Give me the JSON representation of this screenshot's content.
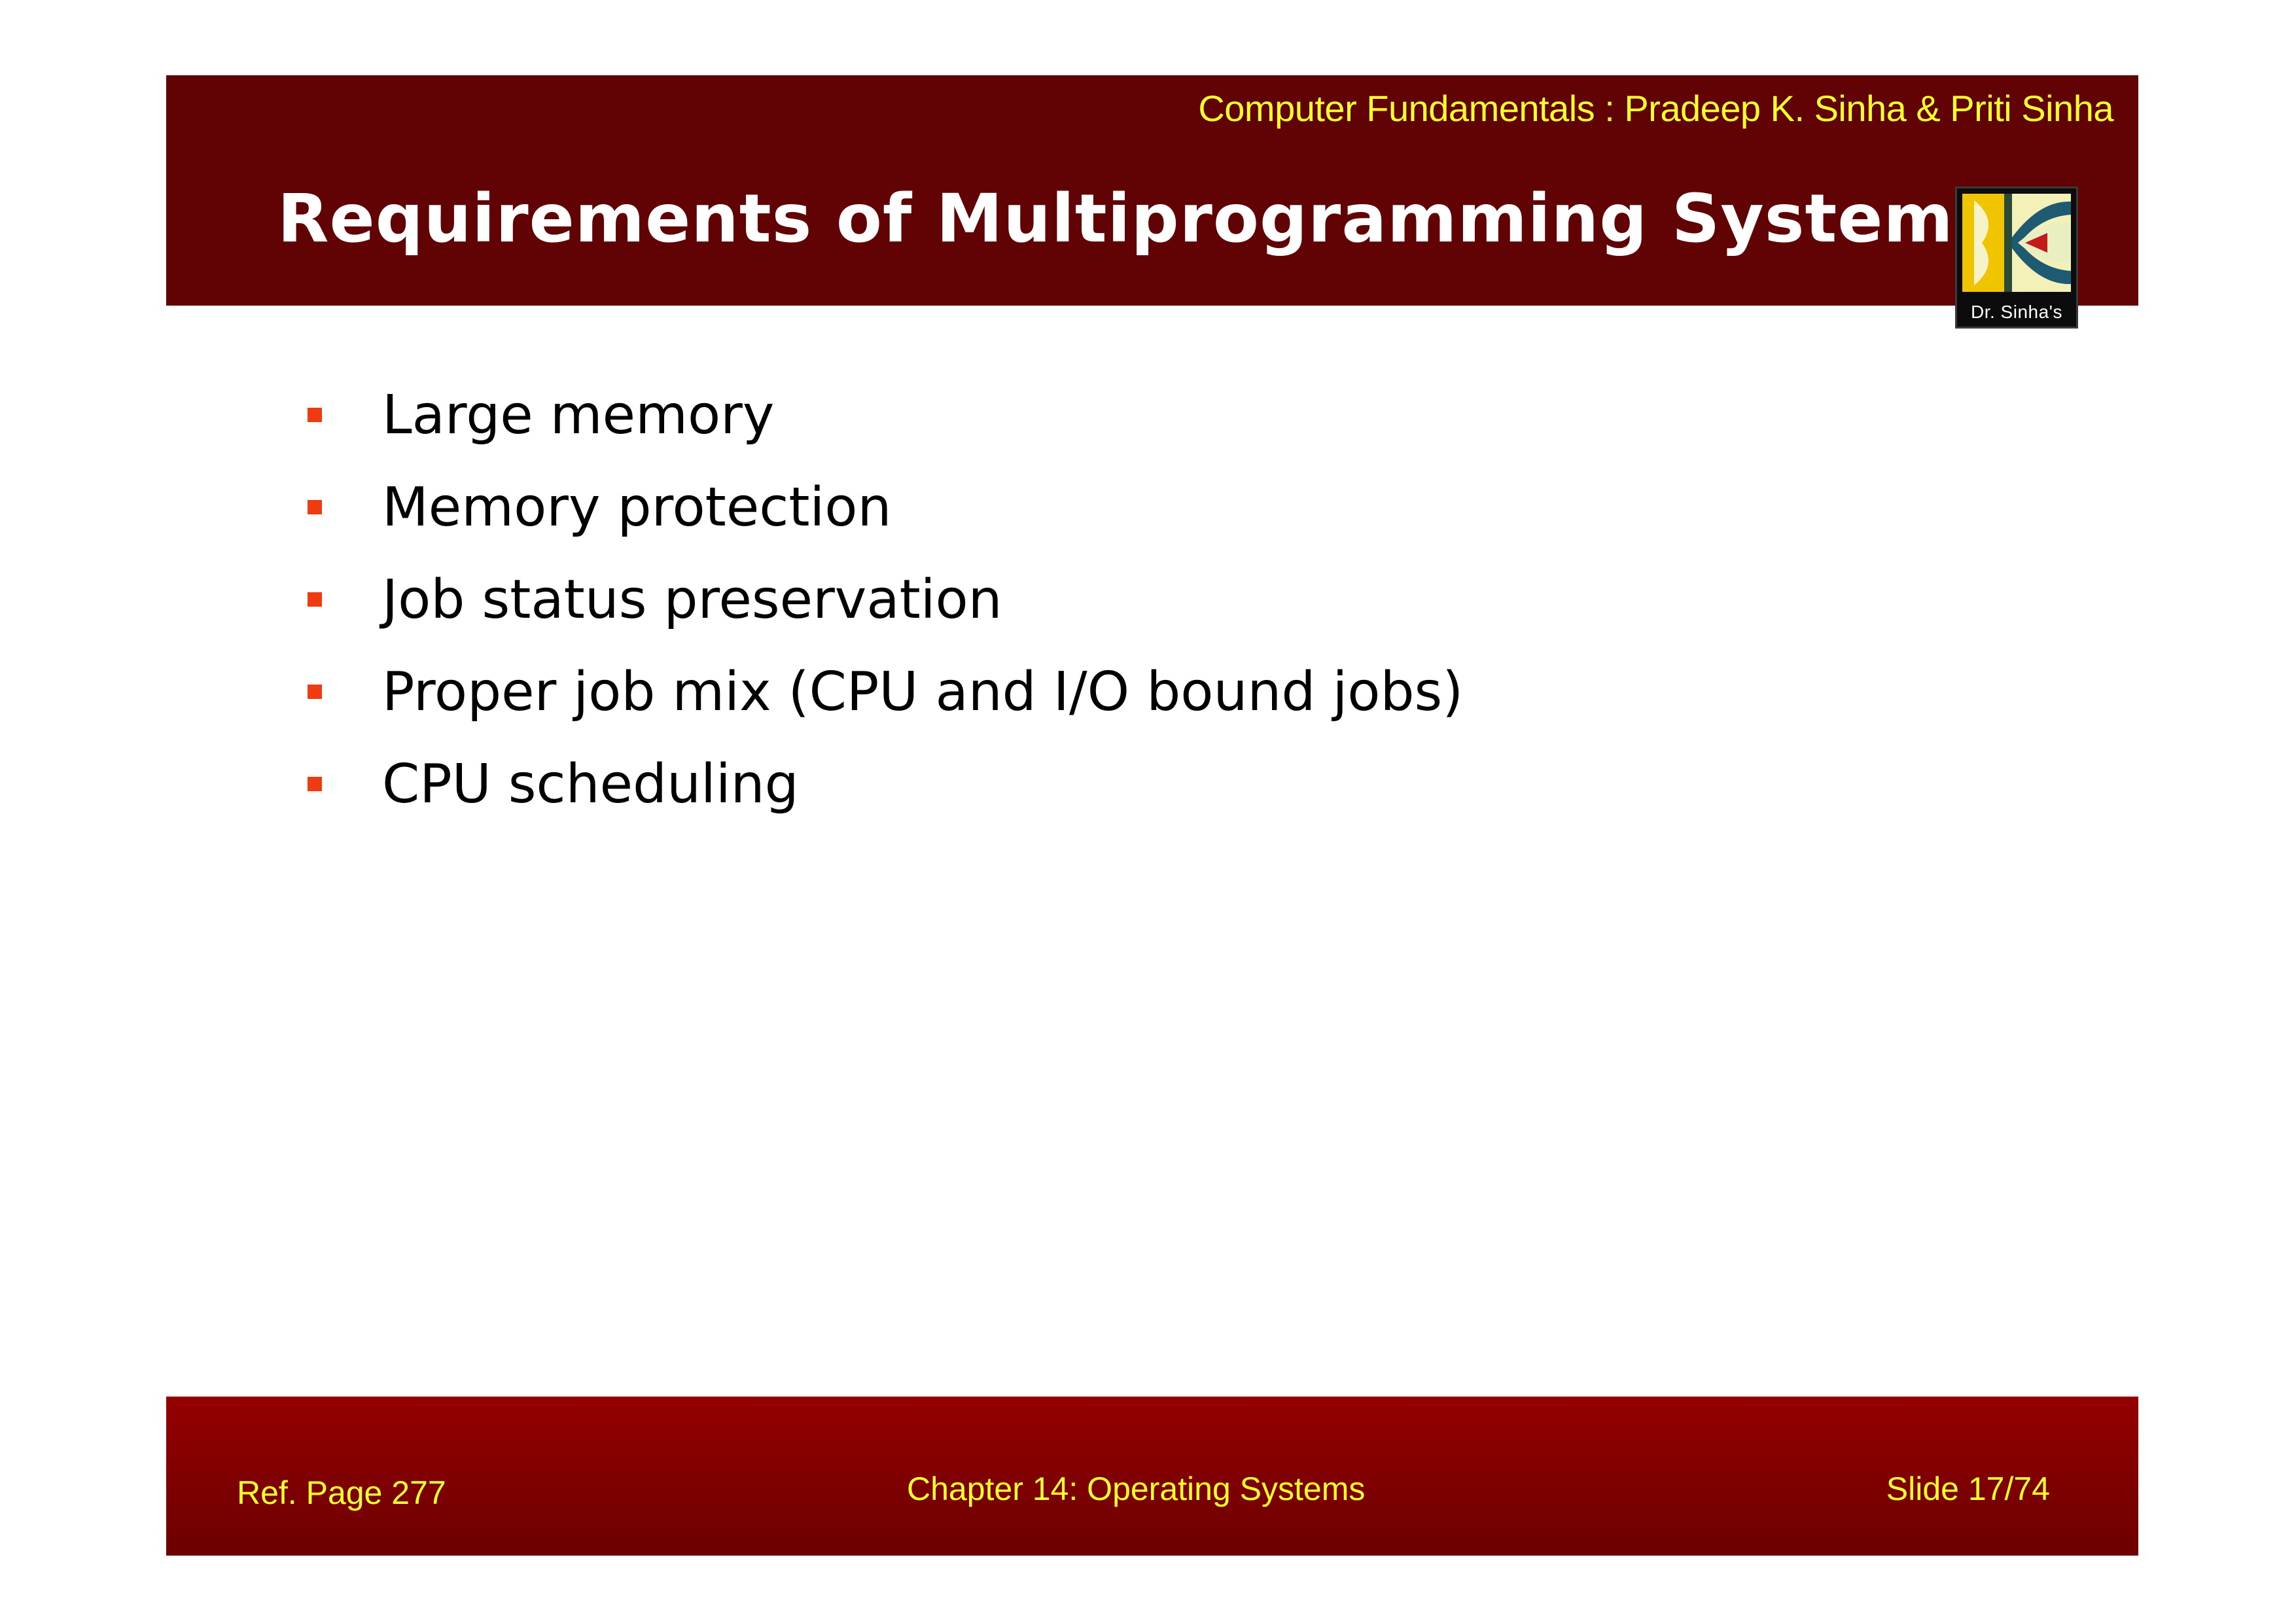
{
  "header": {
    "book_credit": "Computer Fundamentals : Pradeep K. Sinha & Priti Sinha",
    "title": "Requirements of Multiprogramming Systems",
    "logo_caption": "Dr. Sinha's"
  },
  "bullets": [
    "Large memory",
    "Memory protection",
    "Job status preservation",
    "Proper job mix (CPU and I/O bound jobs)",
    "CPU scheduling"
  ],
  "footer": {
    "ref_page": "Ref. Page  277",
    "chapter": "Chapter 14: Operating Systems",
    "slide": "Slide 17/74"
  },
  "colors": {
    "header_bg": "#610204",
    "footer_bg": "#8a0000",
    "accent_yellow": "#ffff2e",
    "bullet_marker": "#ef3b12"
  }
}
